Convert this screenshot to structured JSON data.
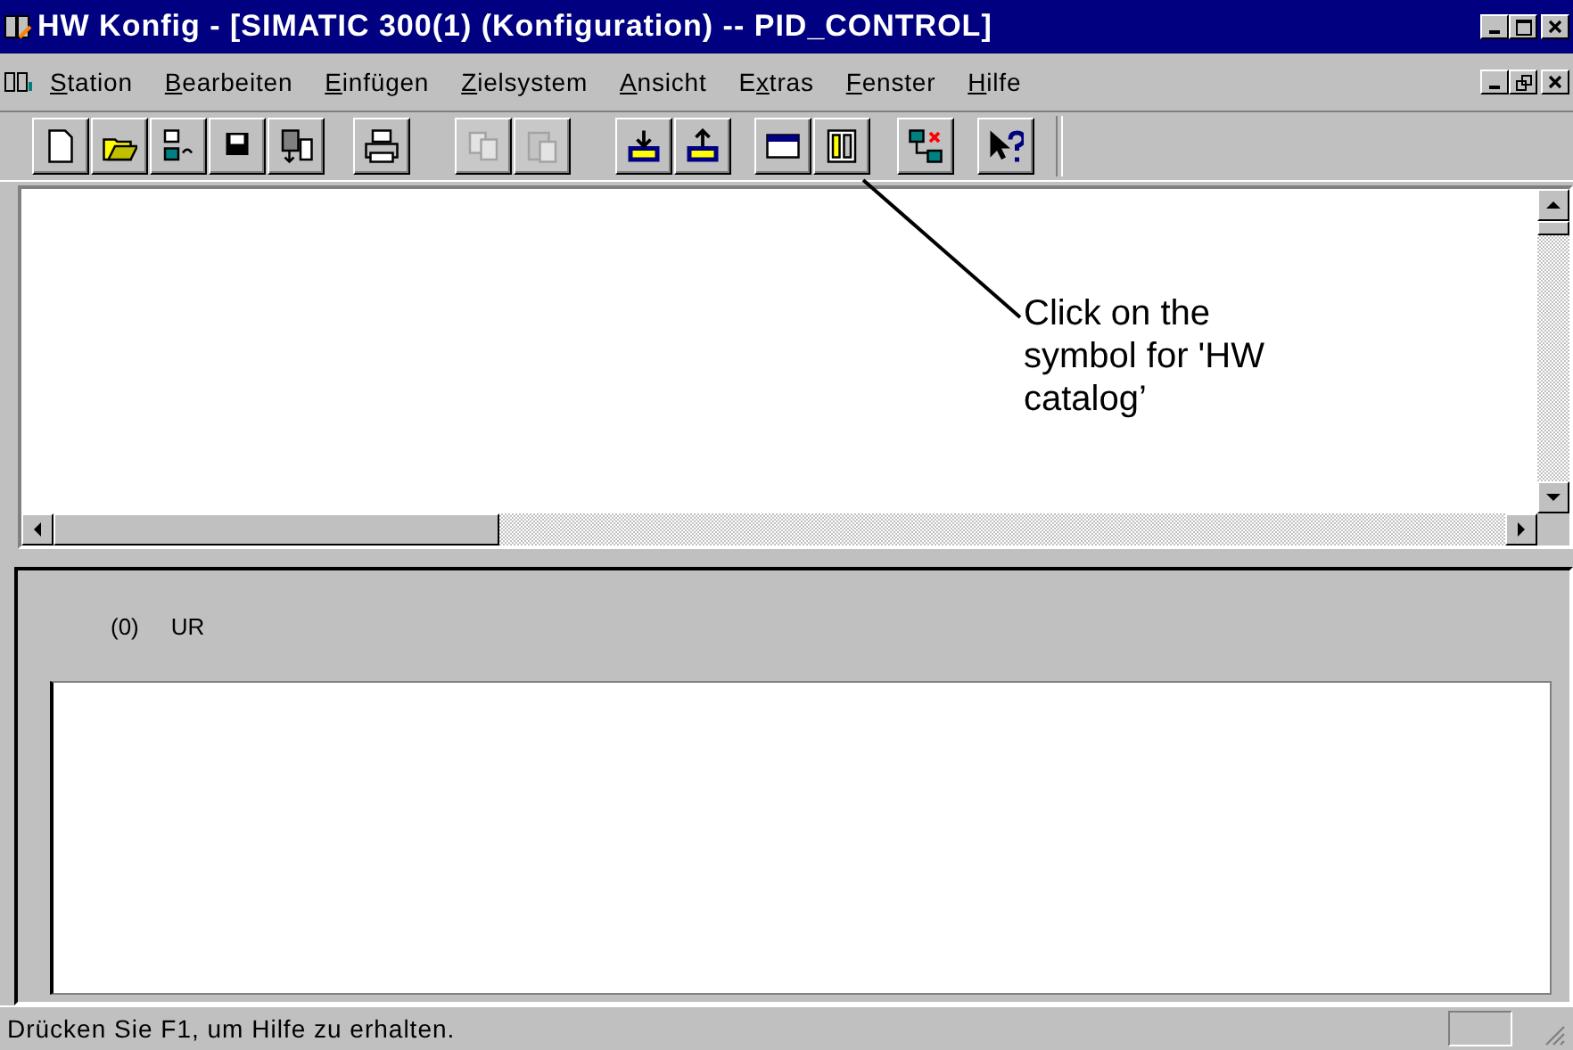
{
  "window": {
    "title": "HW Konfig - [SIMATIC 300(1) (Konfiguration) -- PID_CONTROL]"
  },
  "menu": [
    {
      "key": "S",
      "rest": "tation"
    },
    {
      "key": "B",
      "rest": "earbeiten"
    },
    {
      "key": "E",
      "rest": "infügen"
    },
    {
      "key": "Z",
      "rest": "ielsystem"
    },
    {
      "key": "A",
      "rest": "nsicht"
    },
    {
      "lead": "E",
      "key": "x",
      "rest": "tras"
    },
    {
      "key": "F",
      "rest": "enster"
    },
    {
      "key": "H",
      "rest": "ilfe"
    }
  ],
  "toolbar": {
    "groups": [
      [
        {
          "disabled": false
        },
        {
          "disabled": false
        },
        {
          "disabled": false
        },
        {
          "disabled": false
        },
        {
          "disabled": false
        }
      ],
      [
        {
          "disabled": false
        }
      ],
      [
        {
          "disabled": true
        },
        {
          "disabled": true
        }
      ],
      [
        {
          "disabled": false
        },
        {
          "disabled": false
        }
      ],
      [
        {
          "disabled": false
        },
        {
          "disabled": false
        }
      ],
      [
        {
          "disabled": false
        }
      ],
      [
        {
          "disabled": false
        }
      ]
    ]
  },
  "annotation": {
    "text": "Click on the symbol for 'HW catalog’"
  },
  "rack": {
    "number": "(0)",
    "name": "UR"
  },
  "status_bar": {
    "text": "Drücken Sie F1, um Hilfe zu erhalten."
  }
}
